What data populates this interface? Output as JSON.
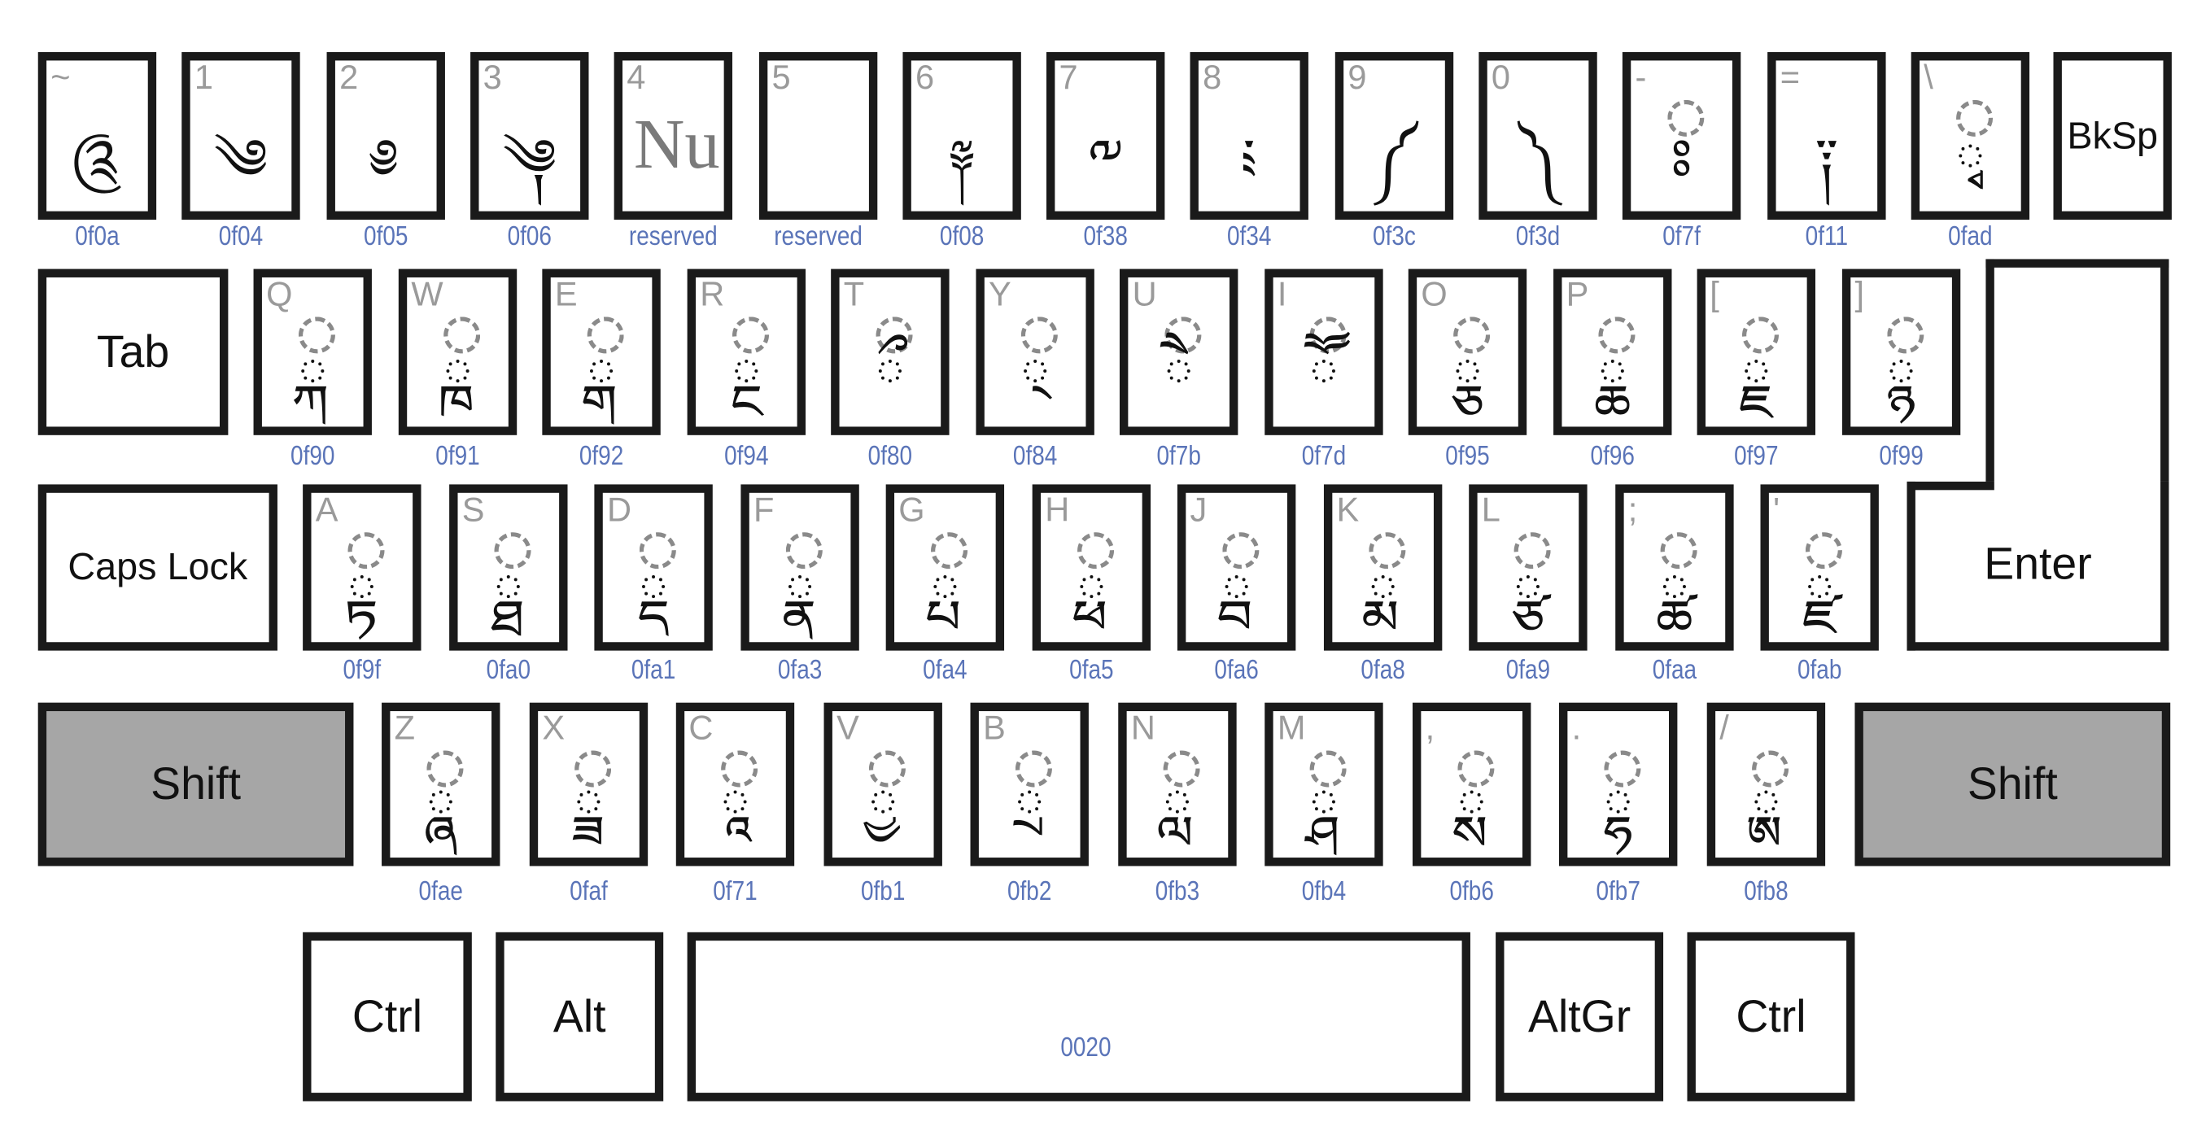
{
  "colors": {
    "key_border": "#1a1a1a",
    "shift_fill": "#a6a6a6",
    "code_label": "#5a74b8",
    "legend": "#9a9a9a"
  },
  "rows": [
    [
      {
        "legend": "~",
        "glyph": "༊",
        "code": "0f0a"
      },
      {
        "legend": "1",
        "glyph": "༄",
        "code": "0f04"
      },
      {
        "legend": "2",
        "glyph": "༅",
        "code": "0f05"
      },
      {
        "legend": "3",
        "glyph": "༆",
        "code": "0f06"
      },
      {
        "legend": "4",
        "text_glyph": "Nu",
        "code": "reserved"
      },
      {
        "legend": "5",
        "glyph": "",
        "code": "reserved"
      },
      {
        "legend": "6",
        "glyph": "༈",
        "code": "0f08"
      },
      {
        "legend": "7",
        "glyph": "༸",
        "code": "0f38"
      },
      {
        "legend": "8",
        "glyph": "༴",
        "code": "0f34"
      },
      {
        "legend": "9",
        "glyph": "༼",
        "code": "0f3c"
      },
      {
        "legend": "0",
        "glyph": "༽",
        "code": "0f3d"
      },
      {
        "legend": "-",
        "glyph": "ཿ",
        "code": "0f7f",
        "combining": true
      },
      {
        "legend": "=",
        "glyph": "༑",
        "code": "0f11"
      },
      {
        "legend": "\\",
        "glyph": "ྭ",
        "code": "0fad",
        "combining": true
      }
    ],
    [
      {
        "legend": "Q",
        "glyph": "ྐ",
        "code": "0f90",
        "combining": true
      },
      {
        "legend": "W",
        "glyph": "ྑ",
        "code": "0f91",
        "combining": true
      },
      {
        "legend": "E",
        "glyph": "ྒ",
        "code": "0f92",
        "combining": true
      },
      {
        "legend": "R",
        "glyph": "ྔ",
        "code": "0f94",
        "combining": true
      },
      {
        "legend": "T",
        "glyph": "ྀ",
        "code": "0f80",
        "combining": true
      },
      {
        "legend": "Y",
        "glyph": "྄",
        "code": "0f84",
        "combining": true
      },
      {
        "legend": "U",
        "glyph": "ཻ",
        "code": "0f7b",
        "combining": true
      },
      {
        "legend": "I",
        "glyph": "ཽ",
        "code": "0f7d",
        "combining": true
      },
      {
        "legend": "O",
        "glyph": "ྕ",
        "code": "0f95",
        "combining": true
      },
      {
        "legend": "P",
        "glyph": "ྖ",
        "code": "0f96",
        "combining": true
      },
      {
        "legend": "[",
        "glyph": "ྗ",
        "code": "0f97",
        "combining": true
      },
      {
        "legend": "]",
        "glyph": "ྙ",
        "code": "0f99",
        "combining": true
      }
    ],
    [
      {
        "legend": "A",
        "glyph": "ྟ",
        "code": "0f9f",
        "combining": true
      },
      {
        "legend": "S",
        "glyph": "ྠ",
        "code": "0fa0",
        "combining": true
      },
      {
        "legend": "D",
        "glyph": "ྡ",
        "code": "0fa1",
        "combining": true
      },
      {
        "legend": "F",
        "glyph": "ྣ",
        "code": "0fa3",
        "combining": true
      },
      {
        "legend": "G",
        "glyph": "ྤ",
        "code": "0fa4",
        "combining": true
      },
      {
        "legend": "H",
        "glyph": "ྥ",
        "code": "0fa5",
        "combining": true
      },
      {
        "legend": "J",
        "glyph": "ྦ",
        "code": "0fa6",
        "combining": true
      },
      {
        "legend": "K",
        "glyph": "ྨ",
        "code": "0fa8",
        "combining": true
      },
      {
        "legend": "L",
        "glyph": "ྩ",
        "code": "0fa9",
        "combining": true
      },
      {
        "legend": ";",
        "glyph": "ྪ",
        "code": "0faa",
        "combining": true
      },
      {
        "legend": "'",
        "glyph": "ྫ",
        "code": "0fab",
        "combining": true
      }
    ],
    [
      {
        "legend": "Z",
        "glyph": "ྮ",
        "code": "0fae",
        "combining": true
      },
      {
        "legend": "X",
        "glyph": "ྯ",
        "code": "0faf",
        "combining": true
      },
      {
        "legend": "C",
        "glyph": "ཱ",
        "code": "0f71",
        "combining": true
      },
      {
        "legend": "V",
        "glyph": "ྱ",
        "code": "0fb1",
        "combining": true
      },
      {
        "legend": "B",
        "glyph": "ྲ",
        "code": "0fb2",
        "combining": true
      },
      {
        "legend": "N",
        "glyph": "ླ",
        "code": "0fb3",
        "combining": true
      },
      {
        "legend": "M",
        "glyph": "ྴ",
        "code": "0fb4",
        "combining": true
      },
      {
        "legend": ",",
        "glyph": "ྶ",
        "code": "0fb6",
        "combining": true
      },
      {
        "legend": ".",
        "glyph": "ྷ",
        "code": "0fb7",
        "combining": true
      },
      {
        "legend": "/",
        "glyph": "ྸ",
        "code": "0fb8",
        "combining": true
      }
    ]
  ],
  "modifiers": {
    "bksp": "BkSp",
    "tab": "Tab",
    "caps": "Caps Lock",
    "enter": "Enter",
    "shift_left": "Shift",
    "shift_right": "Shift",
    "ctrl_left": "Ctrl",
    "alt": "Alt",
    "space_code": "0020",
    "altgr": "AltGr",
    "ctrl_right": "Ctrl"
  }
}
